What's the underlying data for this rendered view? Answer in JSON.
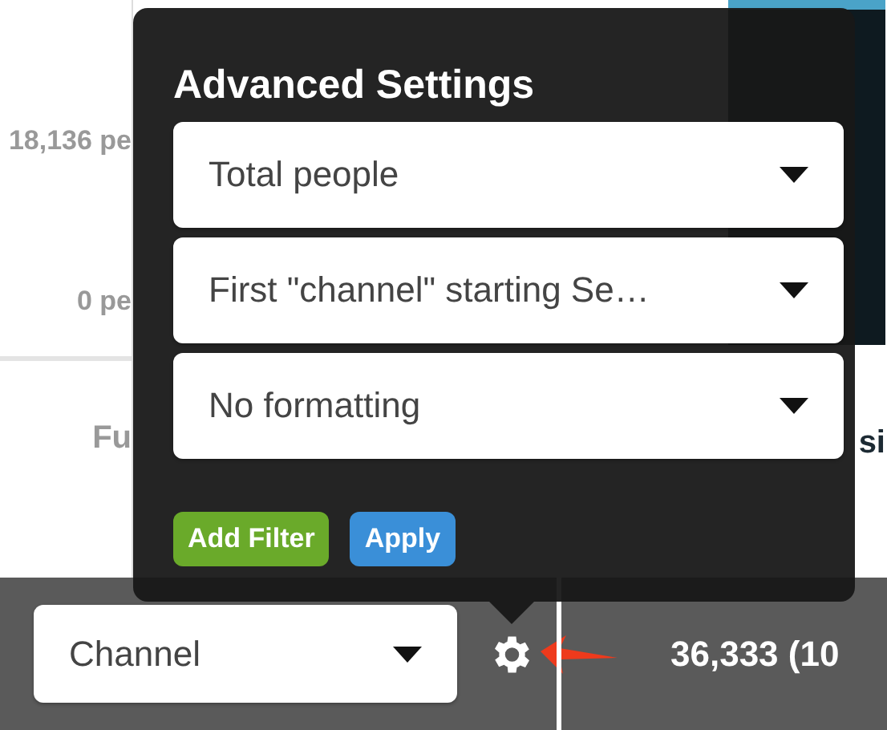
{
  "background_table": {
    "left_values": [
      "18,136 pe",
      "0 pe"
    ],
    "left_footer": "Fu",
    "right_footer": "si"
  },
  "bottom_bar": {
    "select": {
      "value": "Channel"
    },
    "total": "36,333 (10"
  },
  "popover": {
    "title": "Advanced Settings",
    "selects": [
      {
        "value": "Total people"
      },
      {
        "value": "First \"channel\" starting Se…"
      },
      {
        "value": "No formatting"
      }
    ],
    "buttons": [
      {
        "label": "Add Filter",
        "kind": "success"
      },
      {
        "label": "Apply",
        "kind": "primary"
      }
    ]
  }
}
